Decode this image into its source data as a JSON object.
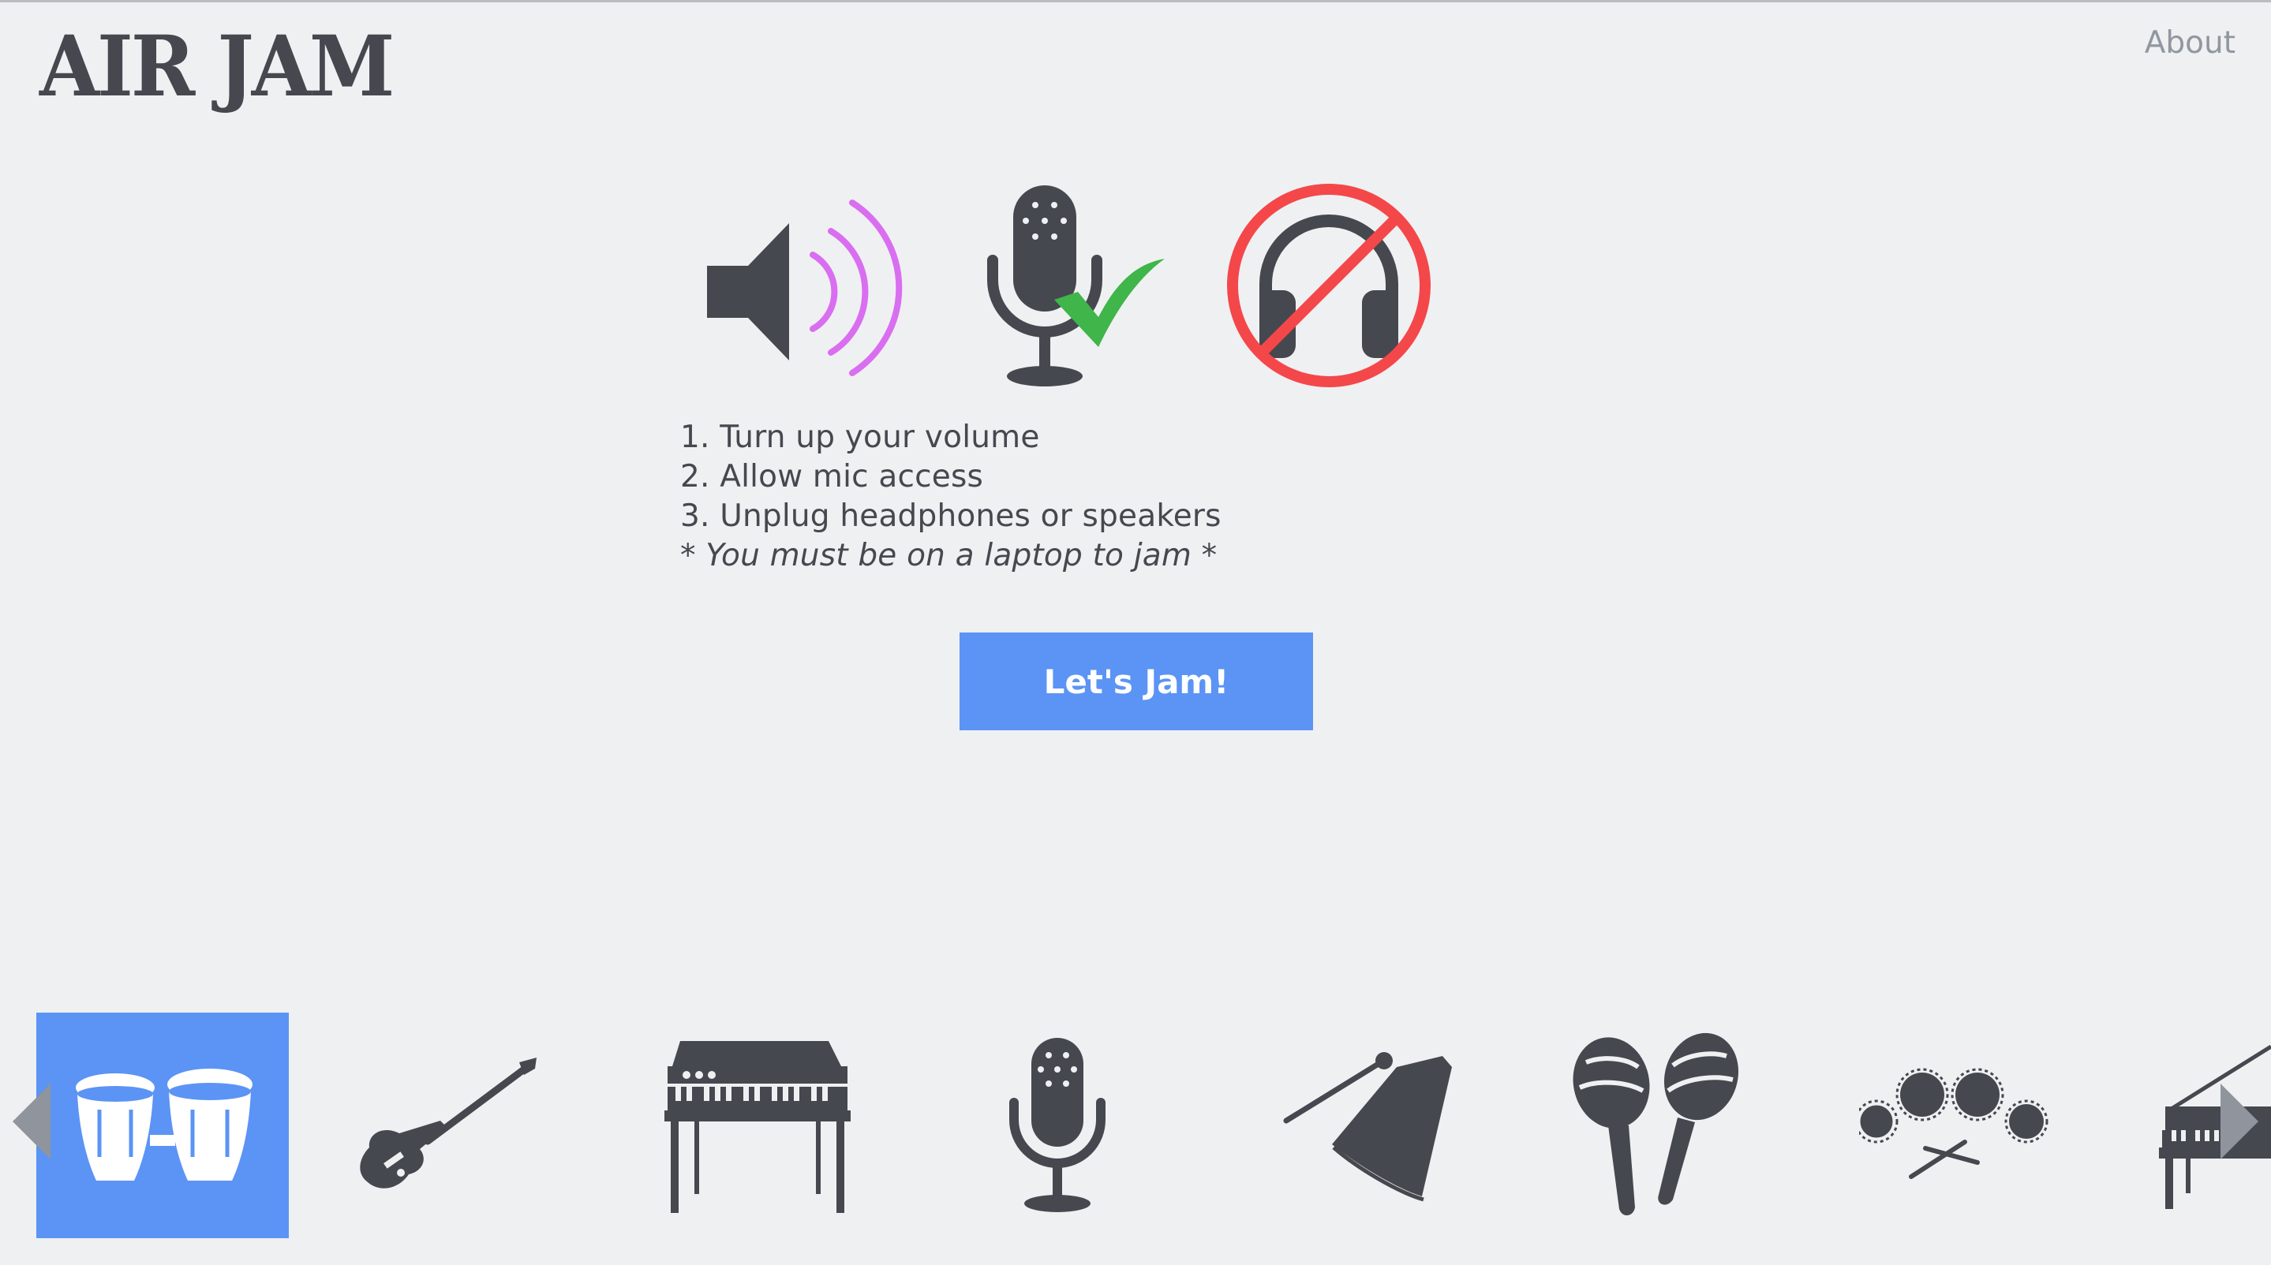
{
  "app": {
    "logo": "AIR JAM",
    "about_link": "About"
  },
  "setup": {
    "icons": [
      "speaker-volume-icon",
      "microphone-check-icon",
      "no-headphones-icon"
    ],
    "steps": [
      "1. Turn up your volume",
      "2. Allow mic access",
      "3. Unplug headphones or speakers"
    ],
    "note": "* You must be on a laptop to jam *",
    "jam_button": "Let's Jam!"
  },
  "instruments": [
    {
      "icon": "bongos-icon",
      "selected": true
    },
    {
      "icon": "electric-guitar-icon",
      "selected": false
    },
    {
      "icon": "synth-keyboard-icon",
      "selected": false
    },
    {
      "icon": "microphone-icon",
      "selected": false
    },
    {
      "icon": "cowbell-icon",
      "selected": false
    },
    {
      "icon": "maracas-icon",
      "selected": false
    },
    {
      "icon": "drum-kit-icon",
      "selected": false
    },
    {
      "icon": "grand-piano-icon",
      "selected": false
    }
  ],
  "colors": {
    "background": "#eff0f2",
    "text": "#45484e",
    "accent_blue": "#5b94f4",
    "speaker_waves": "#d96ef0",
    "check_green": "#3fb54a",
    "prohibit_red": "#f4474a",
    "muted": "#9197a1"
  }
}
